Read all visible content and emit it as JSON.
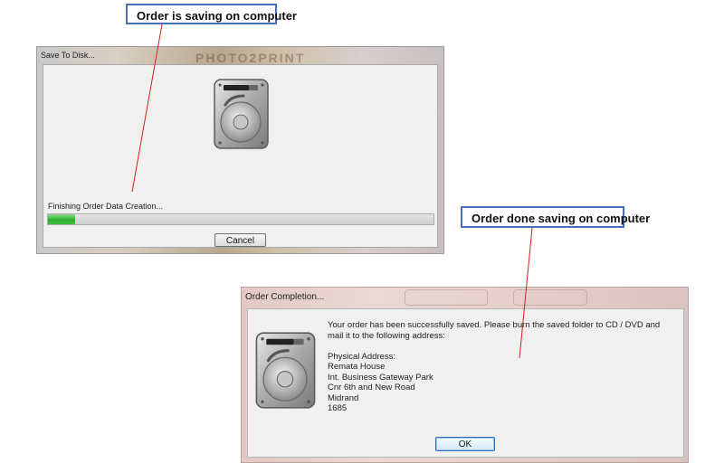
{
  "callouts": {
    "top": "Order is saving on computer",
    "bottom": "Order done saving on computer"
  },
  "save_dialog": {
    "title": "Save To Disk...",
    "brand": "PHOTO2PRINT",
    "status_text": "Finishing Order Data Creation...",
    "progress": 0.07,
    "cancel_label": "Cancel",
    "icon": "hard-disk-icon"
  },
  "completion_dialog": {
    "title": "Order Completion...",
    "message_line1": "Your order has been successfully saved. Please burn the saved folder to CD / DVD and",
    "message_line2": "mail it to the following address:",
    "address_heading": "Physical Address:",
    "address_lines": [
      "Remata House",
      "Int. Business Gateway Park",
      "Cnr 6th and New Road",
      "Midrand",
      "1685"
    ],
    "ok_label": "OK",
    "icon": "hard-disk-icon"
  },
  "colors": {
    "callout_border": "#4a6fb5",
    "connector_line": "#d42020",
    "progress_green": "#2fae2f"
  }
}
